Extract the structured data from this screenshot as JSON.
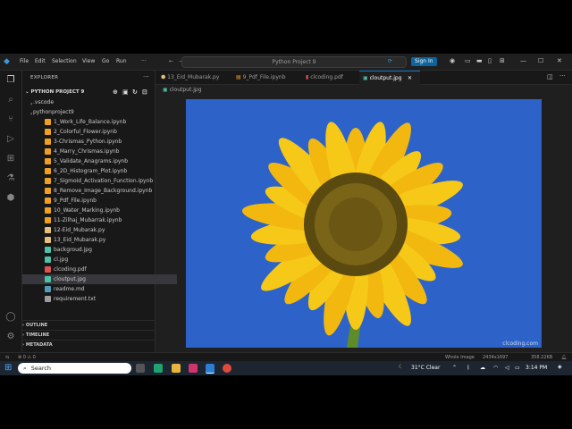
{
  "titlebar": {
    "menu": [
      "File",
      "Edit",
      "Selection",
      "View",
      "Go",
      "Run",
      "···"
    ],
    "command_center": "Python Project 9",
    "signin": "Sign In"
  },
  "explorer": {
    "header": "EXPLORER",
    "project": "PYTHON PROJECT 9",
    "files": [
      {
        "name": ".vscode",
        "type": "folder"
      },
      {
        "name": "pythonproject9",
        "type": "folder"
      },
      {
        "name": "1_Work_Life_Balance.ipynb",
        "type": "ipynb"
      },
      {
        "name": "2_Colorful_Flower.ipynb",
        "type": "ipynb"
      },
      {
        "name": "3-Chrismas_Python.ipynb",
        "type": "ipynb"
      },
      {
        "name": "4_Marry_Chrismas.ipynb",
        "type": "ipynb"
      },
      {
        "name": "5_Validate_Anagrams.ipynb",
        "type": "ipynb"
      },
      {
        "name": "6_2D_Histogram_Plot.ipynb",
        "type": "ipynb"
      },
      {
        "name": "7_Sigmoid_Activation_Function.ipynb",
        "type": "ipynb"
      },
      {
        "name": "8_Remove_Image_Background.ipynb",
        "type": "ipynb"
      },
      {
        "name": "9_Pdf_File.ipynb",
        "type": "ipynb"
      },
      {
        "name": "10_Water_Marking.ipynb",
        "type": "ipynb"
      },
      {
        "name": "11-Zilhaj_Mubarrak.ipynb",
        "type": "ipynb"
      },
      {
        "name": "12-Eid_Mubarak.py",
        "type": "py"
      },
      {
        "name": "13_Eid_Mubarak.py",
        "type": "py"
      },
      {
        "name": "backgroud.jpg",
        "type": "jpg"
      },
      {
        "name": "cl.jpg",
        "type": "jpg"
      },
      {
        "name": "clcoding.pdf",
        "type": "pdf"
      },
      {
        "name": "cloutput.jpg",
        "type": "jpg",
        "selected": true
      },
      {
        "name": "readme.md",
        "type": "md"
      },
      {
        "name": "requirement.txt",
        "type": "txt"
      }
    ],
    "sections": [
      "OUTLINE",
      "TIMELINE",
      "METADATA"
    ]
  },
  "tabs": [
    {
      "label": "13_Eid_Mubarak.py",
      "active": false
    },
    {
      "label": "9_Pdf_File.ipynb",
      "active": false
    },
    {
      "label": "clcoding.pdf",
      "active": false
    },
    {
      "label": "cloutput.jpg",
      "active": true
    }
  ],
  "breadcrumb": "cloutput.jpg",
  "image": {
    "watermark": "clcoding.com",
    "sky_color": "#2d62c8"
  },
  "status": {
    "problems": "⊗ 0 ⚠ 0",
    "zoom": "Whole Image",
    "dimensions": "2434x1697",
    "size": "358.22KB"
  },
  "taskbar": {
    "search": "Search",
    "weather": "31°C  Clear",
    "time": "3:14 PM"
  }
}
